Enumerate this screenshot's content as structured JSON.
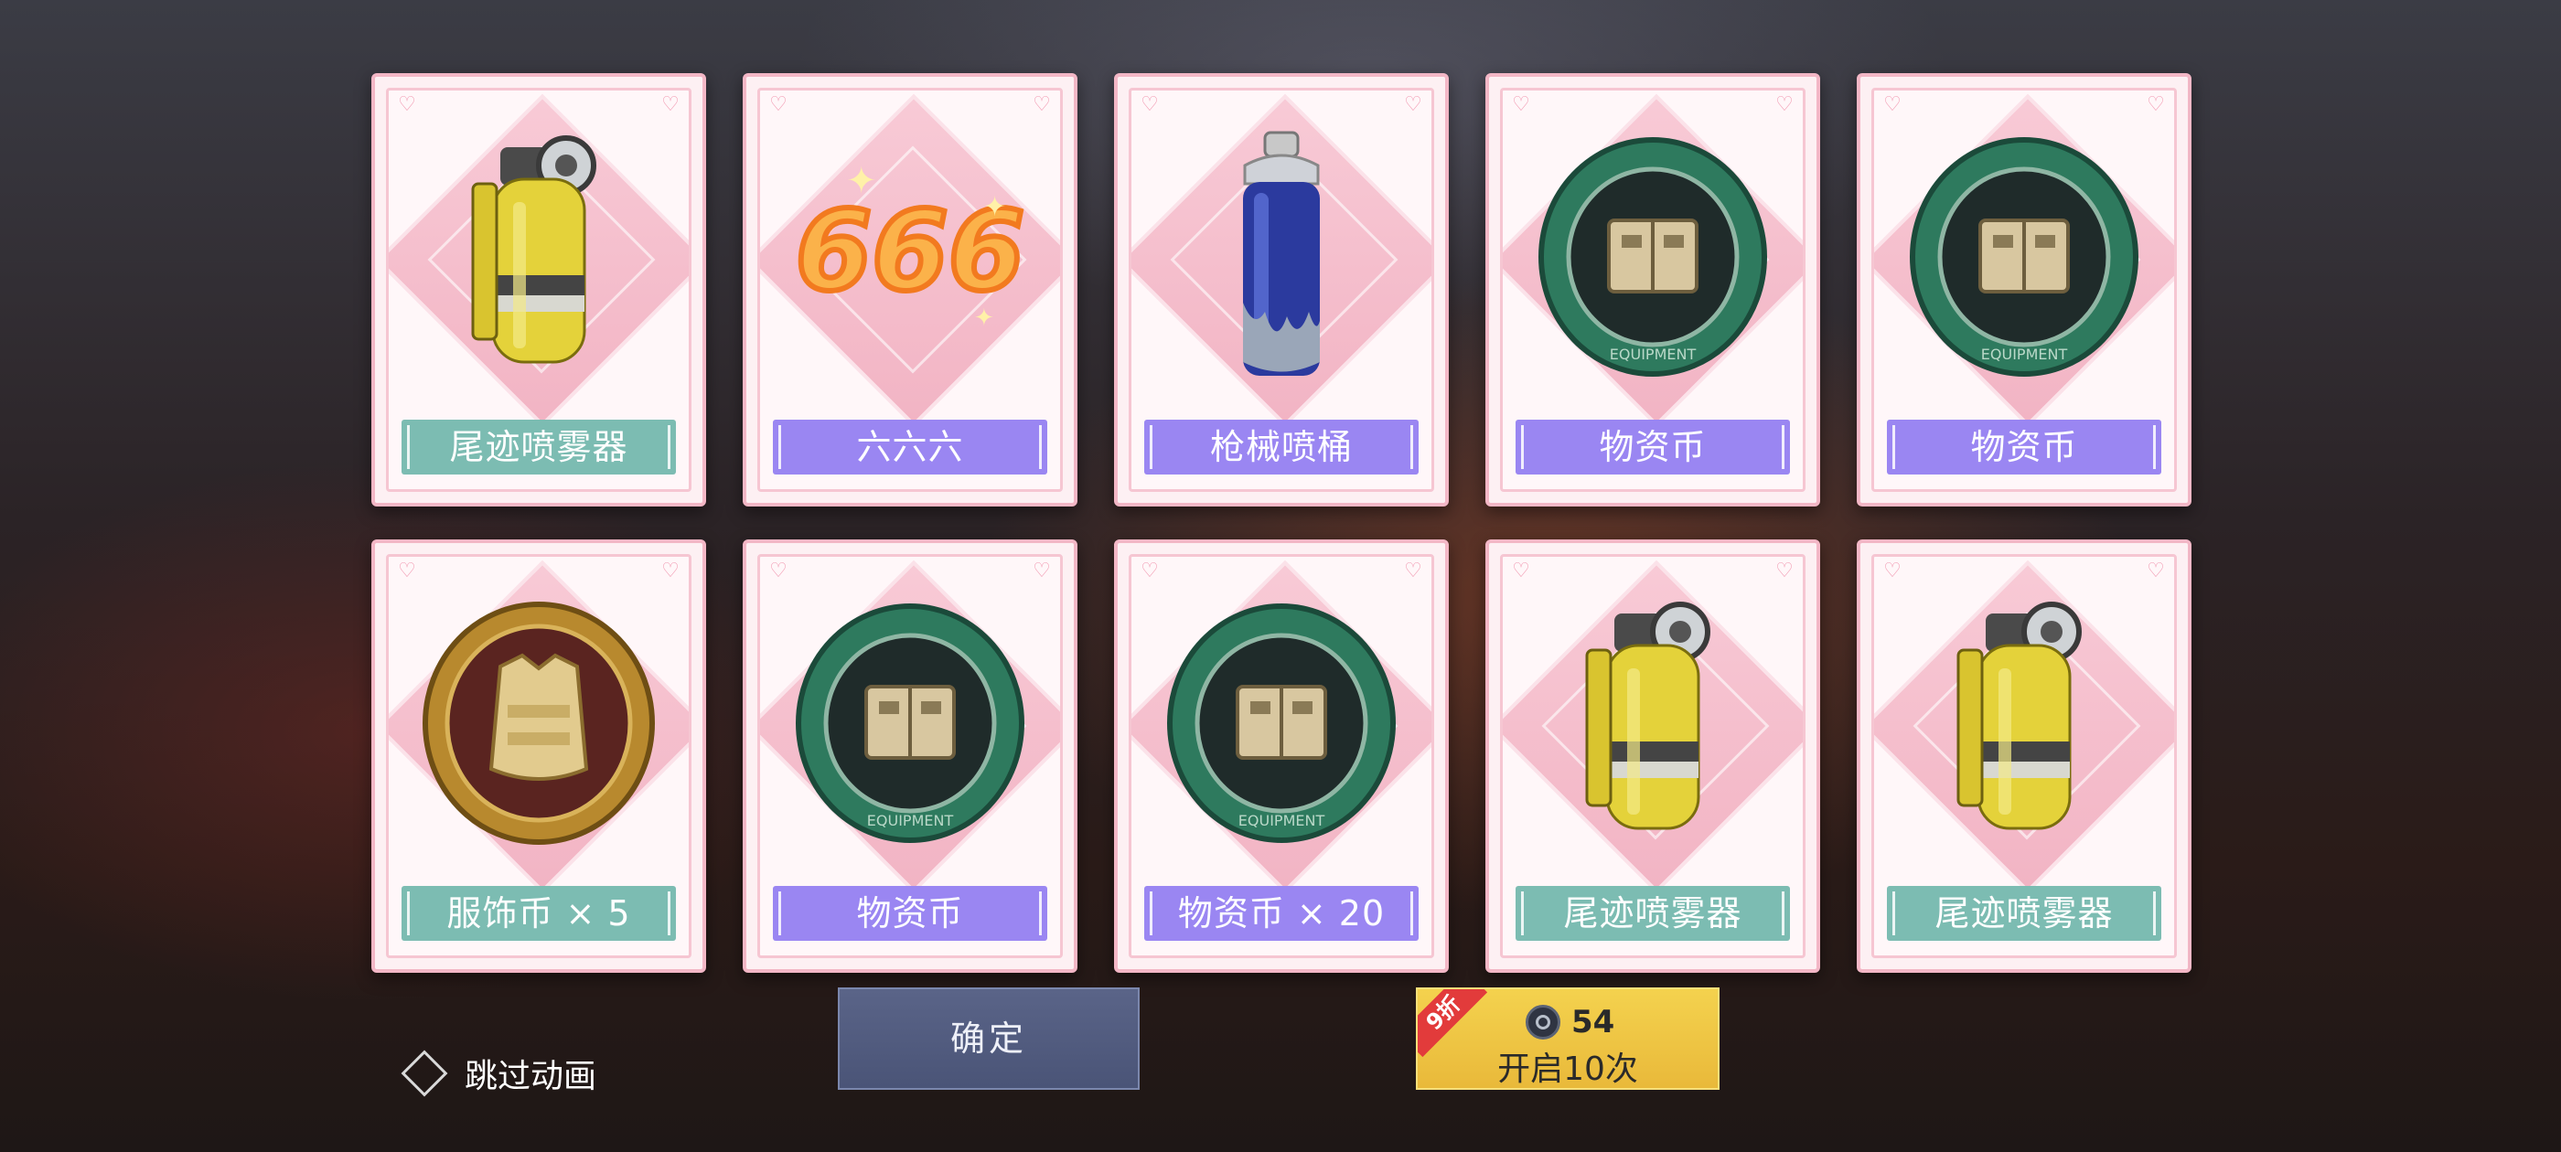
{
  "cards": [
    {
      "label": "尾迹喷雾器",
      "label_color": "teal",
      "item": "smoke-grenade"
    },
    {
      "label": "六六六",
      "label_color": "purple",
      "item": "666-emote"
    },
    {
      "label": "枪械喷桶",
      "label_color": "purple",
      "item": "spray-can"
    },
    {
      "label": "物资币",
      "label_color": "purple",
      "item": "supply-coin"
    },
    {
      "label": "物资币",
      "label_color": "purple",
      "item": "supply-coin"
    },
    {
      "label": "服饰币 × 5",
      "label_color": "teal",
      "item": "outfit-coin"
    },
    {
      "label": "物资币",
      "label_color": "purple",
      "item": "supply-coin"
    },
    {
      "label": "物资币 × 20",
      "label_color": "purple",
      "item": "supply-coin"
    },
    {
      "label": "尾迹喷雾器",
      "label_color": "teal",
      "item": "smoke-grenade"
    },
    {
      "label": "尾迹喷雾器",
      "label_color": "teal",
      "item": "smoke-grenade"
    }
  ],
  "coin_text": {
    "top": "EQUIPMENT",
    "bottom": "EQUIPMENT"
  },
  "emote_text": "666",
  "skip_label": "跳过动画",
  "confirm_label": "确定",
  "open10": {
    "badge": "9折",
    "price": "54",
    "label": "开启10次"
  },
  "colors": {
    "teal": "#7cbcb2",
    "purple": "#9a86f2",
    "card_border": "#f3b7c6",
    "gold_button": "#f4d24e",
    "confirm_button": "#5a6488"
  }
}
